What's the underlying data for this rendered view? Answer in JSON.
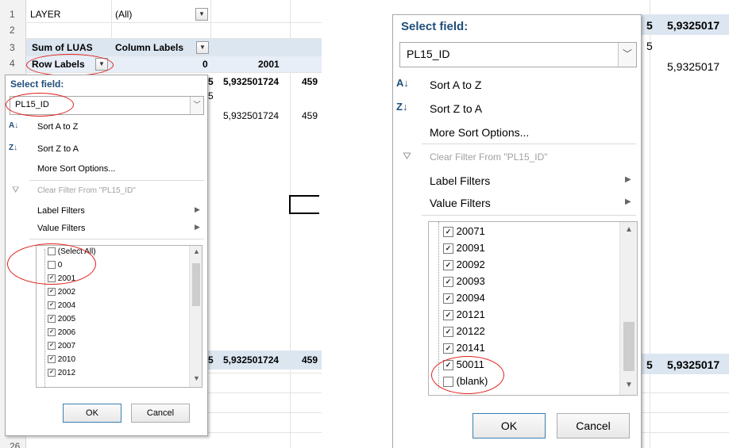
{
  "left_sheet": {
    "row_numbers": [
      "1",
      "2",
      "3",
      "4",
      "26"
    ],
    "layer_label": "LAYER",
    "layer_value": "(All)",
    "sum_label": "Sum of LUAS",
    "col_labels": "Column Labels",
    "row_labels": "Row Labels",
    "col_0": "0",
    "col_2001": "2001",
    "val_top": "5,932501724",
    "val_top_2": "459",
    "val_mid": "5,932501724",
    "val_mid_2": "459",
    "val_bot": "5,932501724",
    "val_bot_2": "459",
    "frag_5": "5"
  },
  "left_menu": {
    "select_field": "Select field:",
    "field_value": "PL15_ID",
    "sort_az": "Sort A to Z",
    "sort_za": "Sort Z to A",
    "more_sort": "More Sort Options...",
    "clear_filter": "Clear Filter From \"PL15_ID\"",
    "label_filters": "Label Filters",
    "value_filters": "Value Filters",
    "items": [
      {
        "label": "(Select All)",
        "checked": false
      },
      {
        "label": "0",
        "checked": false
      },
      {
        "label": "2001",
        "checked": true
      },
      {
        "label": "2002",
        "checked": true
      },
      {
        "label": "2004",
        "checked": true
      },
      {
        "label": "2005",
        "checked": true
      },
      {
        "label": "2006",
        "checked": true
      },
      {
        "label": "2007",
        "checked": true
      },
      {
        "label": "2010",
        "checked": true
      },
      {
        "label": "2012",
        "checked": true
      }
    ],
    "ok": "OK",
    "cancel": "Cancel"
  },
  "right_menu": {
    "select_field": "Select field:",
    "field_value": "PL15_ID",
    "sort_az": "Sort A to Z",
    "sort_za": "Sort Z to A",
    "more_sort": "More Sort Options...",
    "clear_filter": "Clear Filter From \"PL15_ID\"",
    "label_filters": "Label Filters",
    "value_filters": "Value Filters",
    "items": [
      {
        "label": "20071",
        "checked": true
      },
      {
        "label": "20091",
        "checked": true
      },
      {
        "label": "20092",
        "checked": true
      },
      {
        "label": "20093",
        "checked": true
      },
      {
        "label": "20094",
        "checked": true
      },
      {
        "label": "20121",
        "checked": true
      },
      {
        "label": "20122",
        "checked": true
      },
      {
        "label": "20141",
        "checked": true
      },
      {
        "label": "50011",
        "checked": true
      },
      {
        "label": "(blank)",
        "checked": false
      }
    ],
    "ok": "OK",
    "cancel": "Cancel"
  },
  "right_sheet": {
    "val_top": "5,9325017",
    "val_mid": "5,9325017",
    "val_bot": "5,9325017",
    "frag_5": "5"
  },
  "colors": {
    "highlight_red": "#e0201b",
    "pivot_blue": "#dce6f1",
    "menu_accent": "#1f4e79"
  }
}
